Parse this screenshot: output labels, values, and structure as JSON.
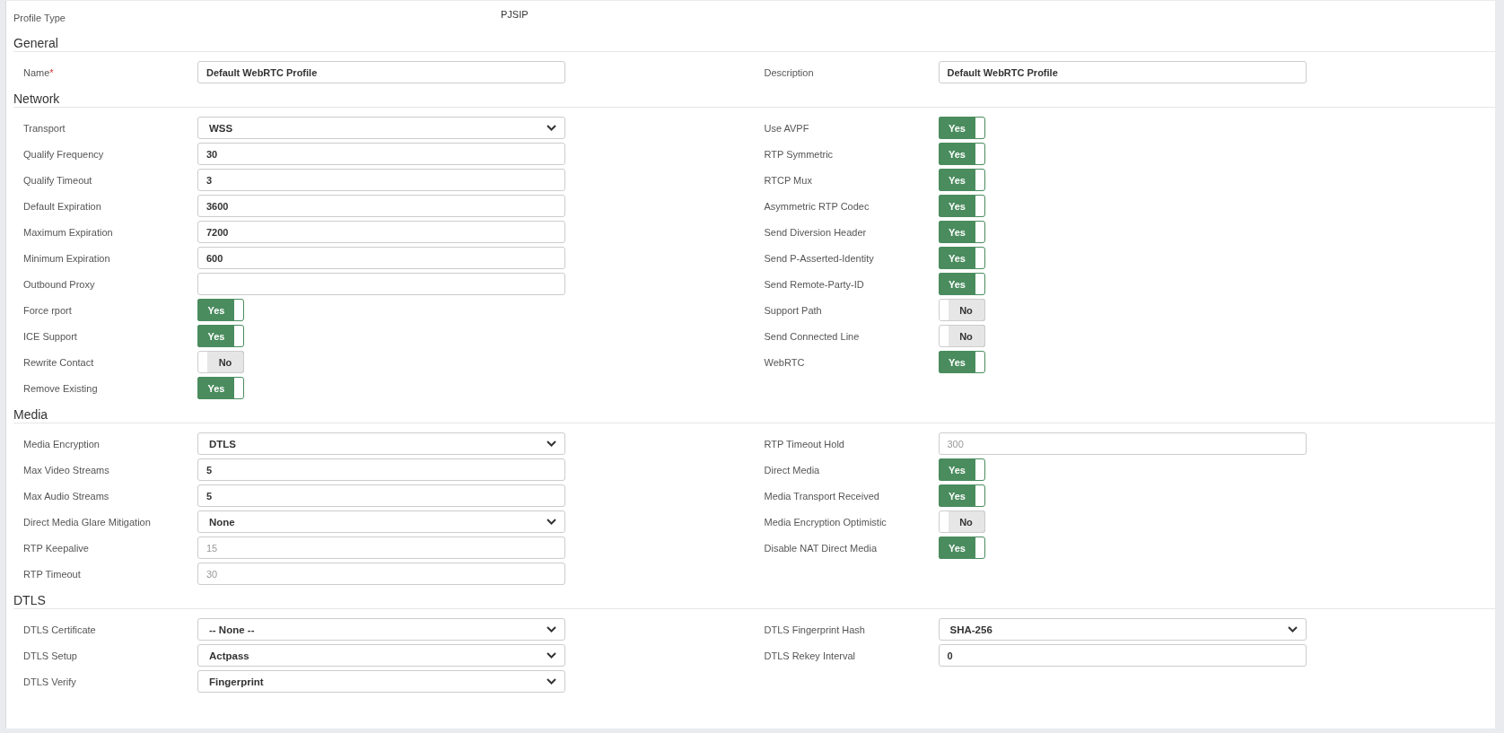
{
  "profile_type": {
    "label": "Profile Type",
    "value": "PJSIP"
  },
  "sections": [
    {
      "title": "General",
      "left": [
        {
          "label": "Name",
          "required_mark": "*",
          "kind": "text",
          "value": "Default WebRTC Profile"
        }
      ],
      "right": [
        {
          "label": "Description",
          "kind": "text",
          "value": "Default WebRTC Profile"
        }
      ]
    },
    {
      "title": "Network",
      "left": [
        {
          "label": "Transport",
          "kind": "select",
          "value": "WSS"
        },
        {
          "label": "Qualify Frequency",
          "kind": "text",
          "value": "30"
        },
        {
          "label": "Qualify Timeout",
          "kind": "text",
          "value": "3"
        },
        {
          "label": "Default Expiration",
          "kind": "text",
          "value": "3600"
        },
        {
          "label": "Maximum Expiration",
          "kind": "text",
          "value": "7200"
        },
        {
          "label": "Minimum Expiration",
          "kind": "text",
          "value": "600"
        },
        {
          "label": "Outbound Proxy",
          "kind": "text"
        },
        {
          "label": "Force rport",
          "kind": "toggle",
          "on": true,
          "text": "Yes"
        },
        {
          "label": "ICE Support",
          "kind": "toggle",
          "on": true,
          "text": "Yes"
        },
        {
          "label": "Rewrite Contact",
          "kind": "toggle",
          "on": false,
          "text": "No"
        },
        {
          "label": "Remove Existing",
          "kind": "toggle",
          "on": true,
          "text": "Yes"
        }
      ],
      "right": [
        {
          "label": "Use AVPF",
          "kind": "toggle",
          "on": true,
          "text": "Yes"
        },
        {
          "label": "RTP Symmetric",
          "kind": "toggle",
          "on": true,
          "text": "Yes"
        },
        {
          "label": "RTCP Mux",
          "kind": "toggle",
          "on": true,
          "text": "Yes"
        },
        {
          "label": "Asymmetric RTP Codec",
          "kind": "toggle",
          "on": true,
          "text": "Yes"
        },
        {
          "label": "Send Diversion Header",
          "kind": "toggle",
          "on": true,
          "text": "Yes"
        },
        {
          "label": "Send P-Asserted-Identity",
          "kind": "toggle",
          "on": true,
          "text": "Yes"
        },
        {
          "label": "Send Remote-Party-ID",
          "kind": "toggle",
          "on": true,
          "text": "Yes"
        },
        {
          "label": "Support Path",
          "kind": "toggle",
          "on": false,
          "text": "No"
        },
        {
          "label": "Send Connected Line",
          "kind": "toggle",
          "on": false,
          "text": "No"
        },
        {
          "label": "WebRTC",
          "kind": "toggle",
          "on": true,
          "text": "Yes"
        }
      ]
    },
    {
      "title": "Media",
      "left": [
        {
          "label": "Media Encryption",
          "kind": "select",
          "value": "DTLS"
        },
        {
          "label": "Max Video Streams",
          "kind": "text",
          "value": "5"
        },
        {
          "label": "Max Audio Streams",
          "kind": "text",
          "value": "5"
        },
        {
          "label": "Direct Media Glare Mitigation",
          "kind": "select",
          "value": "None"
        },
        {
          "label": "RTP Keepalive",
          "kind": "text",
          "placeholder": "15"
        },
        {
          "label": "RTP Timeout",
          "kind": "text",
          "placeholder": "30"
        }
      ],
      "right": [
        {
          "label": "RTP Timeout Hold",
          "kind": "text",
          "placeholder": "300"
        },
        {
          "label": "Direct Media",
          "kind": "toggle",
          "on": true,
          "text": "Yes"
        },
        {
          "label": "Media Transport Received",
          "kind": "toggle",
          "on": true,
          "text": "Yes"
        },
        {
          "label": "Media Encryption Optimistic",
          "kind": "toggle",
          "on": false,
          "text": "No"
        },
        {
          "label": "Disable NAT Direct Media",
          "kind": "toggle",
          "on": true,
          "text": "Yes"
        }
      ]
    },
    {
      "title": "DTLS",
      "left": [
        {
          "label": "DTLS Certificate",
          "kind": "select",
          "value": "-- None --"
        },
        {
          "label": "DTLS Setup",
          "kind": "select",
          "value": "Actpass"
        },
        {
          "label": "DTLS Verify",
          "kind": "select",
          "value": "Fingerprint"
        }
      ],
      "right": [
        {
          "label": "DTLS Fingerprint Hash",
          "kind": "select",
          "value": "SHA-256"
        },
        {
          "label": "DTLS Rekey Interval",
          "kind": "text",
          "value": "0"
        }
      ]
    }
  ]
}
